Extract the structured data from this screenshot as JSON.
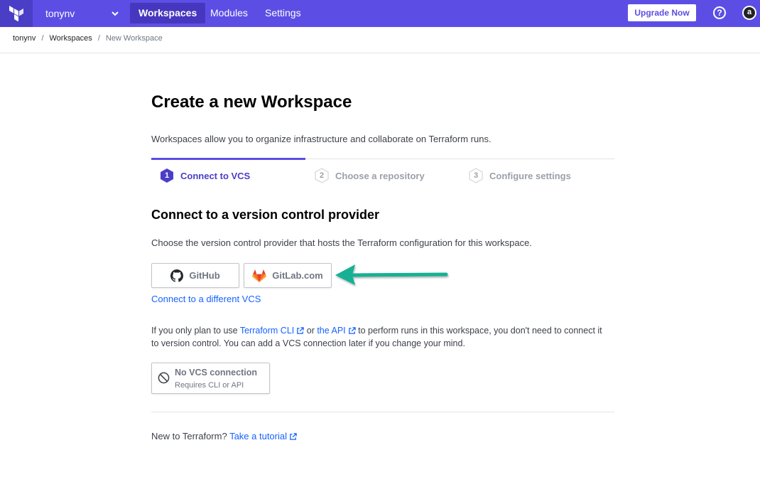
{
  "topbar": {
    "org_name": "tonynv",
    "nav": [
      "Workspaces",
      "Modules",
      "Settings"
    ],
    "upgrade_label": "Upgrade Now",
    "help_glyph": "?",
    "avatar_glyph": "a"
  },
  "breadcrumb": {
    "org": "tonynv",
    "workspaces": "Workspaces",
    "current": "New Workspace",
    "separator": "/"
  },
  "page": {
    "title": "Create a new Workspace",
    "description": "Workspaces allow you to organize infrastructure and collaborate on Terraform runs."
  },
  "steps": [
    {
      "number": "1",
      "label": "Connect to VCS",
      "active": true
    },
    {
      "number": "2",
      "label": "Choose a repository",
      "active": false
    },
    {
      "number": "3",
      "label": "Configure settings",
      "active": false
    }
  ],
  "vcs": {
    "heading": "Connect to a version control provider",
    "instructions": "Choose the version control provider that hosts the Terraform configuration for this workspace.",
    "github_label": "GitHub",
    "gitlab_label": "GitLab.com",
    "different_vcs_link": "Connect to a different VCS"
  },
  "cli_note": {
    "before": "If you only plan to use ",
    "cli_link": "Terraform CLI",
    "or_text": " or ",
    "api_link": "the API",
    "after": " to perform runs in this workspace, you don't need to connect it to version control. You can add a VCS connection later if you change your mind."
  },
  "no_vcs": {
    "title": "No VCS connection",
    "subtitle": "Requires CLI or API"
  },
  "footer": {
    "text": "New to Terraform? ",
    "link": "Take a tutorial"
  },
  "colors": {
    "brand": "#5c4ee5",
    "link": "#1563ff",
    "arrow": "#14b195"
  }
}
